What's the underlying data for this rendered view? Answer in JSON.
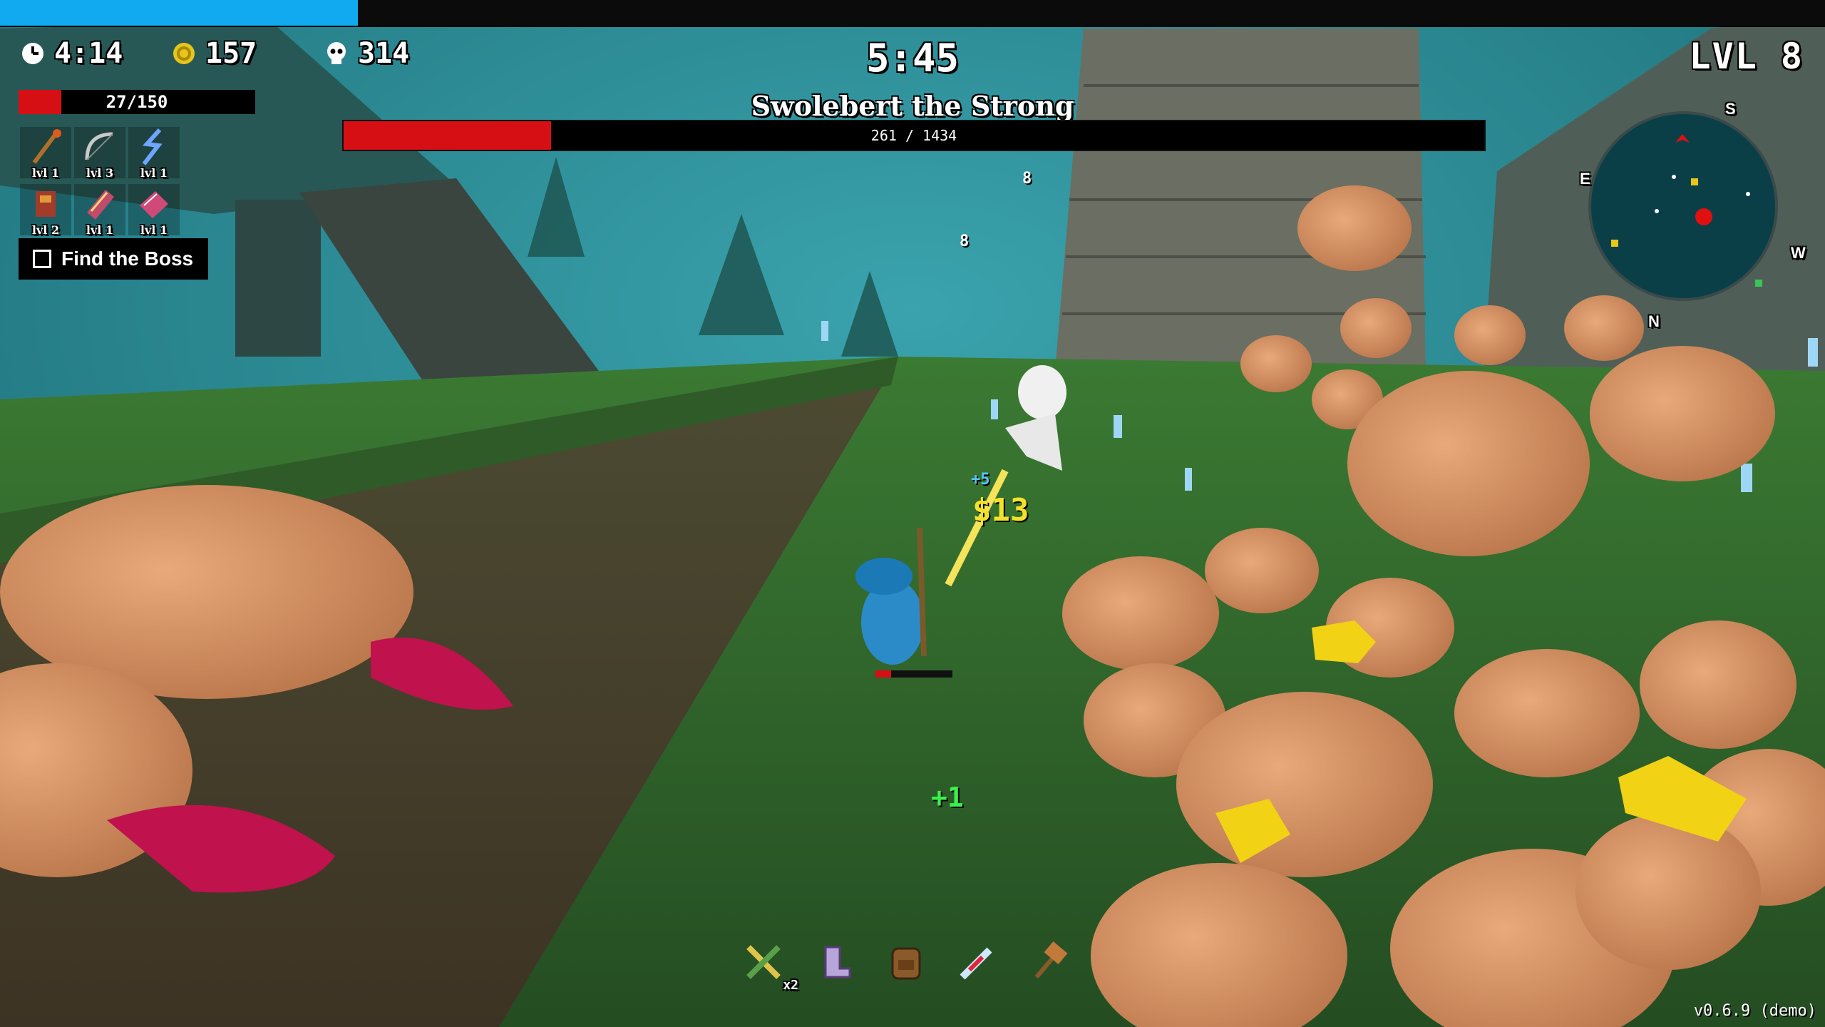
{
  "xp": {
    "fill_fraction": 0.196
  },
  "stats": {
    "survival_time": "4:14",
    "gold": "157",
    "kills": "314"
  },
  "timer": "5:45",
  "level": "LVL 8",
  "boss": {
    "name": "Swolebert the Strong",
    "hp_text": "261 / 1434",
    "hp_current": 261,
    "hp_max": 1434
  },
  "player": {
    "hp_text": "27/150",
    "hp_current": 27,
    "hp_max": 150
  },
  "inventory": [
    {
      "icon": "staff-icon",
      "level": "lvl 1"
    },
    {
      "icon": "bow-icon",
      "level": "lvl 3"
    },
    {
      "icon": "lightning-icon",
      "level": "lvl 1"
    },
    {
      "icon": "armor-icon",
      "level": "lvl 2"
    },
    {
      "icon": "book-icon",
      "level": "lvl 1"
    },
    {
      "icon": "tome-icon",
      "level": "lvl 1"
    }
  ],
  "quest": {
    "label": "Find the Boss",
    "done": false
  },
  "minimap": {
    "n": "N",
    "s": "S",
    "e": "E",
    "w": "W"
  },
  "hotbar": [
    {
      "icon": "crossed-swords-icon",
      "count": "x2"
    },
    {
      "icon": "boots-icon",
      "count": ""
    },
    {
      "icon": "backpack-icon",
      "count": ""
    },
    {
      "icon": "syringe-icon",
      "count": ""
    },
    {
      "icon": "hammer-icon",
      "count": ""
    }
  ],
  "floaters": {
    "damage": "13",
    "pickup": "+1",
    "small_a": "+5",
    "small_b": "8",
    "small_c": "8"
  },
  "version": "v0.6.9 (demo)",
  "colors": {
    "xp": "#11a9f0",
    "hp": "#d60f14",
    "sky": "#2a8c99",
    "grass": "#2f6a2d"
  }
}
